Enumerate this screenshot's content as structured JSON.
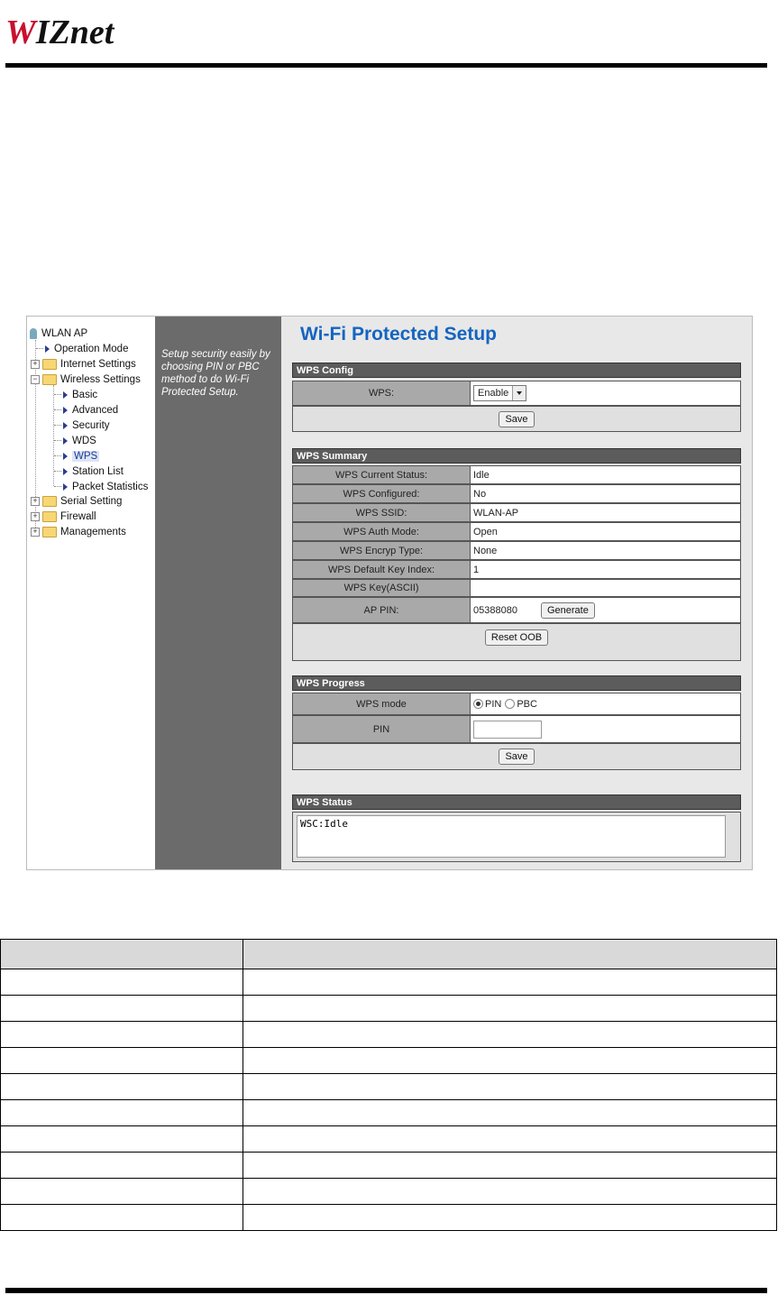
{
  "logo": {
    "w": "W",
    "rest": "IZnet"
  },
  "tree": {
    "root": "WLAN AP",
    "items": [
      {
        "label": "Operation Mode"
      },
      {
        "label": "Internet Settings"
      },
      {
        "label": "Wireless Settings"
      },
      {
        "label": "Basic"
      },
      {
        "label": "Advanced"
      },
      {
        "label": "Security"
      },
      {
        "label": "WDS"
      },
      {
        "label": "WPS"
      },
      {
        "label": "Station List"
      },
      {
        "label": "Packet Statistics"
      },
      {
        "label": "Serial Setting"
      },
      {
        "label": "Firewall"
      },
      {
        "label": "Managements"
      }
    ]
  },
  "help_text": "Setup security easily by choosing PIN or PBC method to do Wi-Fi Protected Setup.",
  "page_title": "Wi-Fi Protected Setup",
  "wps_config": {
    "header": "WPS Config",
    "wps_label": "WPS:",
    "wps_value": "Enable",
    "save_label": "Save"
  },
  "wps_summary": {
    "header": "WPS Summary",
    "rows": [
      {
        "label": "WPS Current Status:",
        "value": "Idle"
      },
      {
        "label": "WPS Configured:",
        "value": "No"
      },
      {
        "label": "WPS SSID:",
        "value": "WLAN-AP"
      },
      {
        "label": "WPS Auth Mode:",
        "value": "Open"
      },
      {
        "label": "WPS Encryp Type:",
        "value": "None"
      },
      {
        "label": "WPS Default Key Index:",
        "value": "1"
      },
      {
        "label": "WPS Key(ASCII)",
        "value": ""
      }
    ],
    "ap_pin_label": "AP PIN:",
    "ap_pin_value": "05388080",
    "generate_label": "Generate",
    "reset_label": "Reset OOB"
  },
  "wps_progress": {
    "header": "WPS Progress",
    "mode_label": "WPS mode",
    "pin_option": "PIN",
    "pbc_option": "PBC",
    "pin_label": "PIN",
    "save_label": "Save"
  },
  "wps_status": {
    "header": "WPS Status",
    "text": "WSC:Idle"
  }
}
